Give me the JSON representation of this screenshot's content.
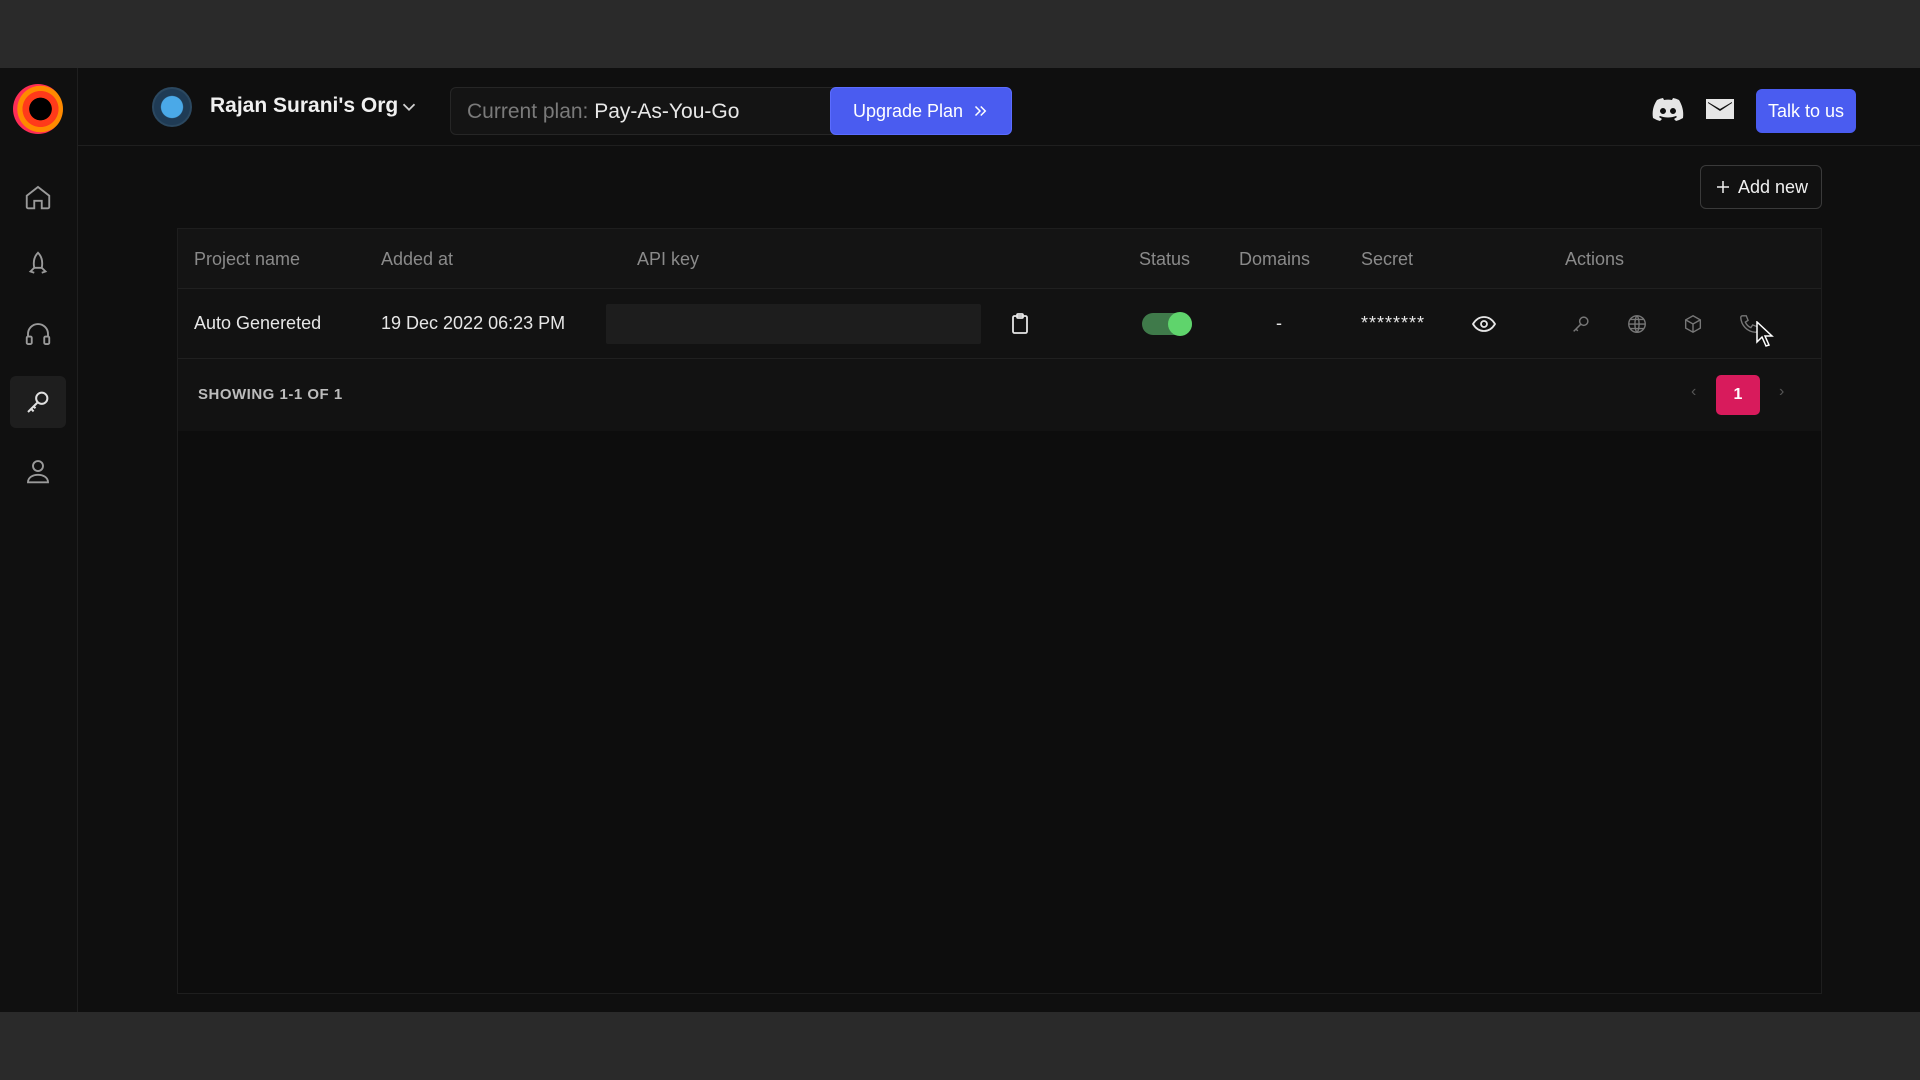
{
  "org": {
    "name": "Rajan Surani's Org"
  },
  "plan": {
    "label": "Current plan:",
    "value": "Pay-As-You-Go",
    "upgrade_label": "Upgrade Plan"
  },
  "header": {
    "talk_label": "Talk to us",
    "icons": [
      "discord-icon",
      "mail-icon"
    ]
  },
  "sidebar": {
    "items": [
      {
        "name": "home",
        "icon": "home-icon"
      },
      {
        "name": "rocket",
        "icon": "rocket-icon"
      },
      {
        "name": "support",
        "icon": "headphones-icon"
      },
      {
        "name": "api-keys",
        "icon": "key-icon",
        "active": true
      },
      {
        "name": "account",
        "icon": "user-icon"
      }
    ]
  },
  "toolbar": {
    "add_new_label": "Add new"
  },
  "table": {
    "columns": [
      "Project name",
      "Added at",
      "API key",
      "Status",
      "Domains",
      "Secret",
      "Actions"
    ],
    "rows": [
      {
        "project_name": "Auto Genereted",
        "added_at": "19 Dec 2022 06:23 PM",
        "api_key": "",
        "status_on": true,
        "domains": "-",
        "secret": "********"
      }
    ],
    "showing": "SHOWING 1-1 OF 1",
    "pagination": {
      "prev": "‹",
      "current": "1",
      "next": "›"
    }
  },
  "colors": {
    "accent": "#4a5cf0",
    "page_active": "#d81b5c",
    "toggle_on": "#5fd46c"
  }
}
